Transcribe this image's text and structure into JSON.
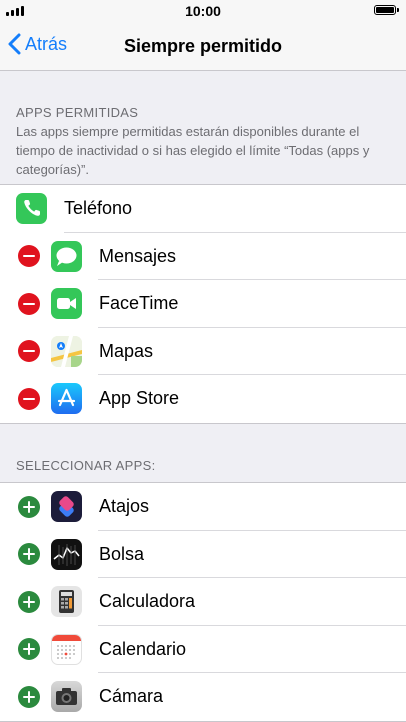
{
  "status_bar": {
    "time": "10:00"
  },
  "nav": {
    "back_label": "Atrás",
    "title": "Siempre permitido"
  },
  "allowed_section": {
    "header": "APPS PERMITIDAS",
    "description": "Las apps siempre permitidas estarán disponibles durante el tiempo de inactividad o si has elegido el límite “Todas (apps y categorías)”.",
    "items": [
      {
        "label": "Teléfono",
        "icon": "phone-icon",
        "control": "none"
      },
      {
        "label": "Mensajes",
        "icon": "messages-icon",
        "control": "remove"
      },
      {
        "label": "FaceTime",
        "icon": "facetime-icon",
        "control": "remove"
      },
      {
        "label": "Mapas",
        "icon": "maps-icon",
        "control": "remove"
      },
      {
        "label": "App Store",
        "icon": "app-store-icon",
        "control": "remove"
      }
    ]
  },
  "select_section": {
    "header": "SELECCIONAR APPS:",
    "items": [
      {
        "label": "Atajos",
        "icon": "shortcuts-icon",
        "control": "add"
      },
      {
        "label": "Bolsa",
        "icon": "stocks-icon",
        "control": "add"
      },
      {
        "label": "Calculadora",
        "icon": "calculator-icon",
        "control": "add"
      },
      {
        "label": "Calendario",
        "icon": "calendar-icon",
        "control": "add"
      },
      {
        "label": "Cámara",
        "icon": "camera-icon",
        "control": "add"
      }
    ]
  },
  "colors": {
    "accent": "#147efb",
    "remove": "#e0131e",
    "add": "#2b8a3e",
    "background": "#efeff4"
  }
}
